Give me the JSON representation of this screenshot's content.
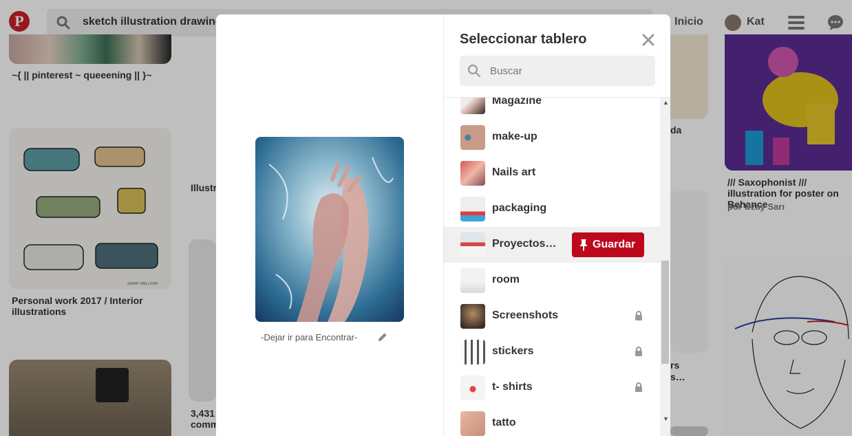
{
  "topbar": {
    "logo": "P",
    "search_query": "sketch illustration drawing",
    "nav_home": "Inicio",
    "nav_user": "Kat"
  },
  "background_pins": {
    "caption_1": "~{ || pinterest ~ queeening || }~",
    "caption_2": "Personal work 2017 / Interior illustrations",
    "caption_3": "Illustr",
    "caption_4": "3,431",
    "caption_4b": "comm",
    "caption_5": "da",
    "caption_6": "rs",
    "caption_6b": "s…",
    "caption_7": "/// Saxophonist /// illustration for poster on Behance",
    "caption_7_author": "por Uzay Sarı",
    "sofa_credit": "SAHNY VAN LOON"
  },
  "modal": {
    "title": "Seleccionar tablero",
    "pin_description": "-Dejar ir para Encontrar-",
    "search_placeholder": "Buscar",
    "save_label": "Guardar",
    "boards": [
      {
        "name": "Magazine",
        "secret": false
      },
      {
        "name": "make-up",
        "secret": false
      },
      {
        "name": "Nails art",
        "secret": false
      },
      {
        "name": "packaging",
        "secret": false
      },
      {
        "name": "Proyectos…",
        "secret": false,
        "hovered": true
      },
      {
        "name": "room",
        "secret": false
      },
      {
        "name": "Screenshots",
        "secret": true
      },
      {
        "name": "stickers",
        "secret": true
      },
      {
        "name": "t- shirts",
        "secret": true
      },
      {
        "name": "tatto",
        "secret": false
      }
    ]
  },
  "colors": {
    "brand_red": "#bd081c",
    "overlay": "rgba(0,0,0,0.25)"
  }
}
